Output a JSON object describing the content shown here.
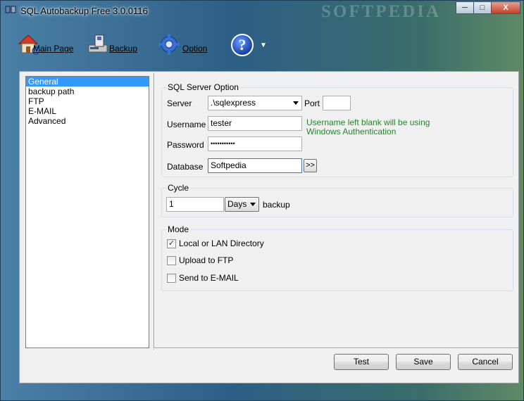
{
  "window": {
    "title": "SQL Autobackup Free 3.0.0116",
    "watermark": "SOFTPEDIA",
    "minimize": "─",
    "maximize": "□",
    "close": "X"
  },
  "toolbar": {
    "main_page": "Main Page",
    "backup": "Backup",
    "option": "Option",
    "help_symbol": "?",
    "help_dropdown": "▼"
  },
  "nav": {
    "items": [
      "General",
      "backup path",
      "FTP",
      "E-MAIL",
      "Advanced"
    ],
    "selected": "General"
  },
  "sql_server": {
    "title": "SQL Server Option",
    "server_label": "Server",
    "server_value": ".\\sqlexpress",
    "port_label": "Port",
    "port_value": "",
    "username_label": "Username",
    "username_value": "tester",
    "note": "Username left blank will be using Windows Authentication",
    "password_label": "Password",
    "password_value": "•••••••••••",
    "database_label": "Database",
    "database_value": "Softpedia",
    "browse_label": ">>"
  },
  "cycle": {
    "title": "Cycle",
    "value": "1",
    "unit": "Days",
    "suffix": "backup"
  },
  "mode": {
    "title": "Mode",
    "options": [
      {
        "label": "Local or LAN Directory",
        "checked": true,
        "mark": "✓"
      },
      {
        "label": "Upload to FTP",
        "checked": false,
        "mark": ""
      },
      {
        "label": "Send to E-MAIL",
        "checked": false,
        "mark": ""
      }
    ]
  },
  "buttons": {
    "test": "Test",
    "save": "Save",
    "cancel": "Cancel"
  },
  "colors": {
    "accent": "#3399ff",
    "note": "#22862a"
  }
}
